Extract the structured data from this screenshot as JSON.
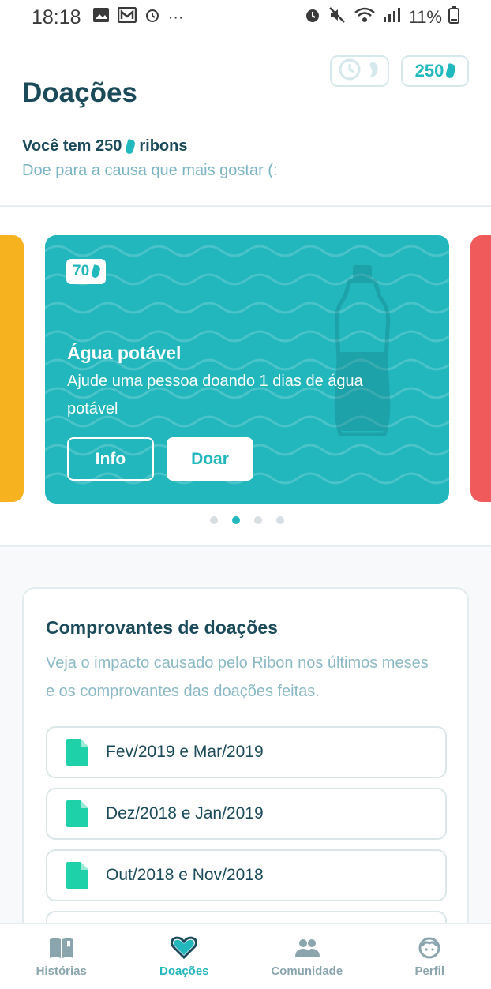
{
  "status_bar": {
    "time": "18:18",
    "ellipsis": "···",
    "battery": "11%"
  },
  "header": {
    "title": "Doações",
    "balance": "250",
    "you_have_prefix": "Você tem 250",
    "you_have_suffix": "ribons",
    "subtitle": "Doe para a causa que mais gostar (:"
  },
  "carousel": {
    "card": {
      "cost": "70",
      "title": "Água potável",
      "description": "Ajude uma pessoa doando 1 dias de água potável",
      "info_label": "Info",
      "donate_label": "Doar"
    },
    "page_count": 4,
    "active_page": 2
  },
  "receipts": {
    "title": "Comprovantes de doações",
    "description": "Veja o impacto causado pelo Ribon nos últimos meses e os comprovantes das doações feitas.",
    "items": [
      {
        "label": "Fev/2019 e Mar/2019"
      },
      {
        "label": "Dez/2018 e Jan/2019"
      },
      {
        "label": "Out/2018 e Nov/2018"
      }
    ]
  },
  "bottom_nav": {
    "items": [
      {
        "label": "Histórias",
        "icon": "book-icon"
      },
      {
        "label": "Doações",
        "icon": "heart-icon",
        "active": true
      },
      {
        "label": "Comunidade",
        "icon": "community-icon"
      },
      {
        "label": "Perfil",
        "icon": "profile-icon"
      }
    ]
  },
  "colors": {
    "accent": "#22b6bd",
    "title": "#1b4a5a",
    "muted": "#7bb5c3",
    "left_card": "#f6b21f",
    "right_card": "#f05a5a",
    "doc_icon": "#1fd1a8"
  }
}
